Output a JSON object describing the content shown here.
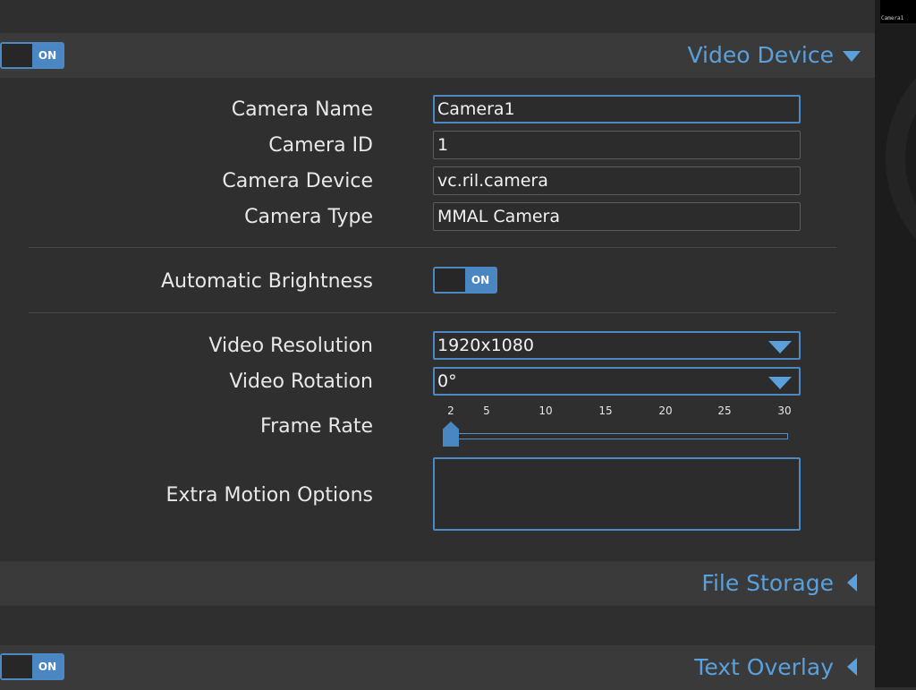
{
  "sections": {
    "video_device": {
      "title": "Video Device",
      "toggle": "ON"
    },
    "file_storage": {
      "title": "File Storage"
    },
    "text_overlay": {
      "title": "Text Overlay",
      "toggle": "ON"
    }
  },
  "fields": {
    "camera_name": {
      "label": "Camera Name",
      "value": "Camera1"
    },
    "camera_id": {
      "label": "Camera ID",
      "value": "1"
    },
    "camera_device": {
      "label": "Camera Device",
      "value": "vc.ril.camera"
    },
    "camera_type": {
      "label": "Camera Type",
      "value": "MMAL Camera"
    },
    "auto_brightness": {
      "label": "Automatic Brightness",
      "toggle": "ON"
    },
    "video_resolution": {
      "label": "Video Resolution",
      "value": "1920x1080"
    },
    "video_rotation": {
      "label": "Video Rotation",
      "value": "0°"
    },
    "frame_rate": {
      "label": "Frame Rate",
      "value": 2,
      "ticks": [
        "2",
        "5",
        "10",
        "15",
        "20",
        "25",
        "30"
      ]
    },
    "extra_motion": {
      "label": "Extra Motion Options",
      "value": ""
    }
  },
  "sidebar": {
    "thumbnail_label": "Camera1"
  },
  "colors": {
    "accent": "#5aa0dc",
    "toggle_on": "#4a86c2",
    "background": "#2f2f2f",
    "section_bar": "#3a3a3a"
  },
  "icons": {
    "section_open": "caret-down-icon",
    "section_closed": "caret-left-icon",
    "dropdown": "dropdown-arrow-icon"
  }
}
